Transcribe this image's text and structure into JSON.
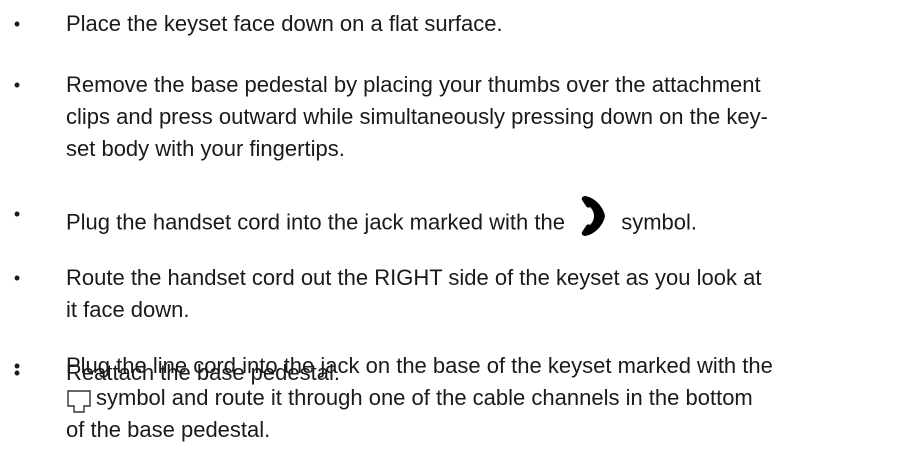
{
  "instructions": {
    "items": [
      {
        "text": "Place the keyset face down on a flat surface."
      },
      {
        "lines": [
          "Remove the base pedestal by placing your thumbs over the attachment",
          "clips and press outward while simultaneously pressing down on the key-",
          "set body with your fingertips."
        ]
      },
      {
        "before": "Plug the handset cord into the jack marked with the",
        "icon": "handset-icon",
        "after": "symbol."
      },
      {
        "lines": [
          "Route the handset cord out the RIGHT side of the keyset as you look at",
          "it face down."
        ]
      },
      {
        "text": "Reattach the base pedestal."
      },
      {
        "line1": "Plug the line cord into the jack on the base of the keyset marked with the",
        "icon": "line-jack-icon",
        "line2": "symbol and route it through one of the cable channels in the bottom",
        "line3": "of the base pedestal."
      }
    ],
    "bullet": "•"
  }
}
